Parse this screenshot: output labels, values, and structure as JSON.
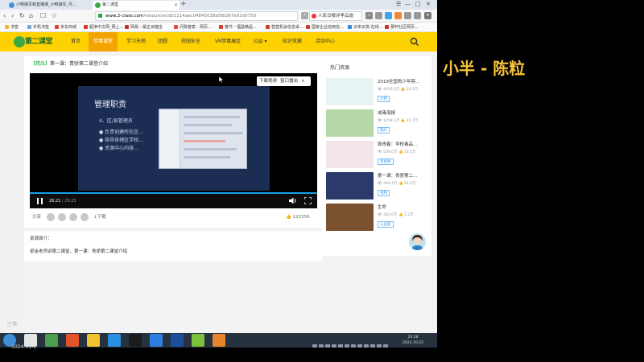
{
  "browser": {
    "tabs": [
      {
        "label": "小鸭接写和直播课_小鸭接写_尽...",
        "active": false
      },
      {
        "label": "第二课堂",
        "active": true
      }
    ],
    "window_controls": [
      "☰",
      "—",
      "□",
      "✕"
    ],
    "address": {
      "host": "www.2-class.com",
      "path": "/resources/d01114aec04845038a5fb287e93d0750"
    },
    "search": {
      "value": "人民日报评李云迪"
    },
    "bookmarks": [
      {
        "label": "书签",
        "color": "#f3b33d"
      },
      {
        "label": "手机书签",
        "color": "#7aa6d6"
      },
      {
        "label": "京东商城",
        "color": "#e33d33"
      },
      {
        "label": "超净中文网_网上...",
        "color": "#d23c2c"
      },
      {
        "label": "网易 - 最正派健全",
        "color": "#c8302a"
      },
      {
        "label": "问我答案 - 网页...",
        "color": "#e24c36"
      },
      {
        "label": "春节 - 福昌精品...",
        "color": "#dd3a2f"
      },
      {
        "label": "营营机会信息采...",
        "color": "#d2382d"
      },
      {
        "label": "国家企业信用信...",
        "color": "#c93a30"
      },
      {
        "label": "识米识货-在线...",
        "color": "#2d8bd8"
      },
      {
        "label": "那怀社区网页...",
        "color": "#c9322c"
      },
      {
        "label": "国家企业信...",
        "color": "#d23c2c"
      }
    ]
  },
  "site": {
    "logo_text": "第二课堂",
    "nav": [
      {
        "label": "首页",
        "active": false
      },
      {
        "label": "禁毒课堂",
        "active": true
      },
      {
        "label": "学习天地",
        "active": false
      },
      {
        "label": "团圆",
        "active": false
      },
      {
        "label": "校园安全",
        "active": false
      },
      {
        "label": "VR禁毒展区",
        "active": false
      },
      {
        "label": "公益 ▾",
        "active": false
      },
      {
        "label": "知识竞赛",
        "active": false
      },
      {
        "label": "活动中心",
        "active": false
      }
    ],
    "accent": "#fed200"
  },
  "video": {
    "tag": "【精品】",
    "title": "第一课：青骄第二课堂介绍",
    "download_label": "下载视频",
    "popout_label": "窗口播出",
    "close_label": "×",
    "current_time": "26:21",
    "total_time": "/ 26:25",
    "progress": 0.997,
    "slide": {
      "heading": "管理职责",
      "lines": [
        "4、区/县管理员",
        "● 负责创建所在区...",
        "● 指导各辖区学校...",
        "● 资源中心内容..."
      ]
    }
  },
  "actions": {
    "share_label": "分享",
    "download_label": "↓下载",
    "likes": "121556"
  },
  "description": {
    "label": "资源简介：",
    "text": "梁金老师讲第二课堂，第一课：青骄第二课堂介绍"
  },
  "sidebar": {
    "heading": "热门资源",
    "items": [
      {
        "title": "2019全国青少年禁...",
        "views": "4016.0万",
        "likes": "16.1万",
        "badge": "文档",
        "thumb": "#e8f4f4"
      },
      {
        "title": "戒毒海报",
        "views": "1058.1万",
        "likes": "19.7万",
        "badge": "图片",
        "thumb": "#b7d9a8"
      },
      {
        "title": "致青春：学校毒品...",
        "views": "559.0万",
        "likes": "14.5万",
        "badge": "音视频",
        "thumb": "#f4e6e8"
      },
      {
        "title": "第一课：青骄第二...",
        "views": "384.4万",
        "likes": "12.2万",
        "badge": "视频",
        "thumb": "#2a3a6a"
      },
      {
        "title": "生命",
        "views": "263.0万",
        "likes": "3.2万",
        "badge": "公益版",
        "thumb": "#7a5230"
      }
    ]
  },
  "taskbar": {
    "clock_time": "20:28",
    "clock_date": "2021-10-22"
  },
  "overlay": {
    "teacher_name": "小半 - 陈粒",
    "watermark_top": "三年",
    "watermark_bottom": "3024-11-1"
  }
}
